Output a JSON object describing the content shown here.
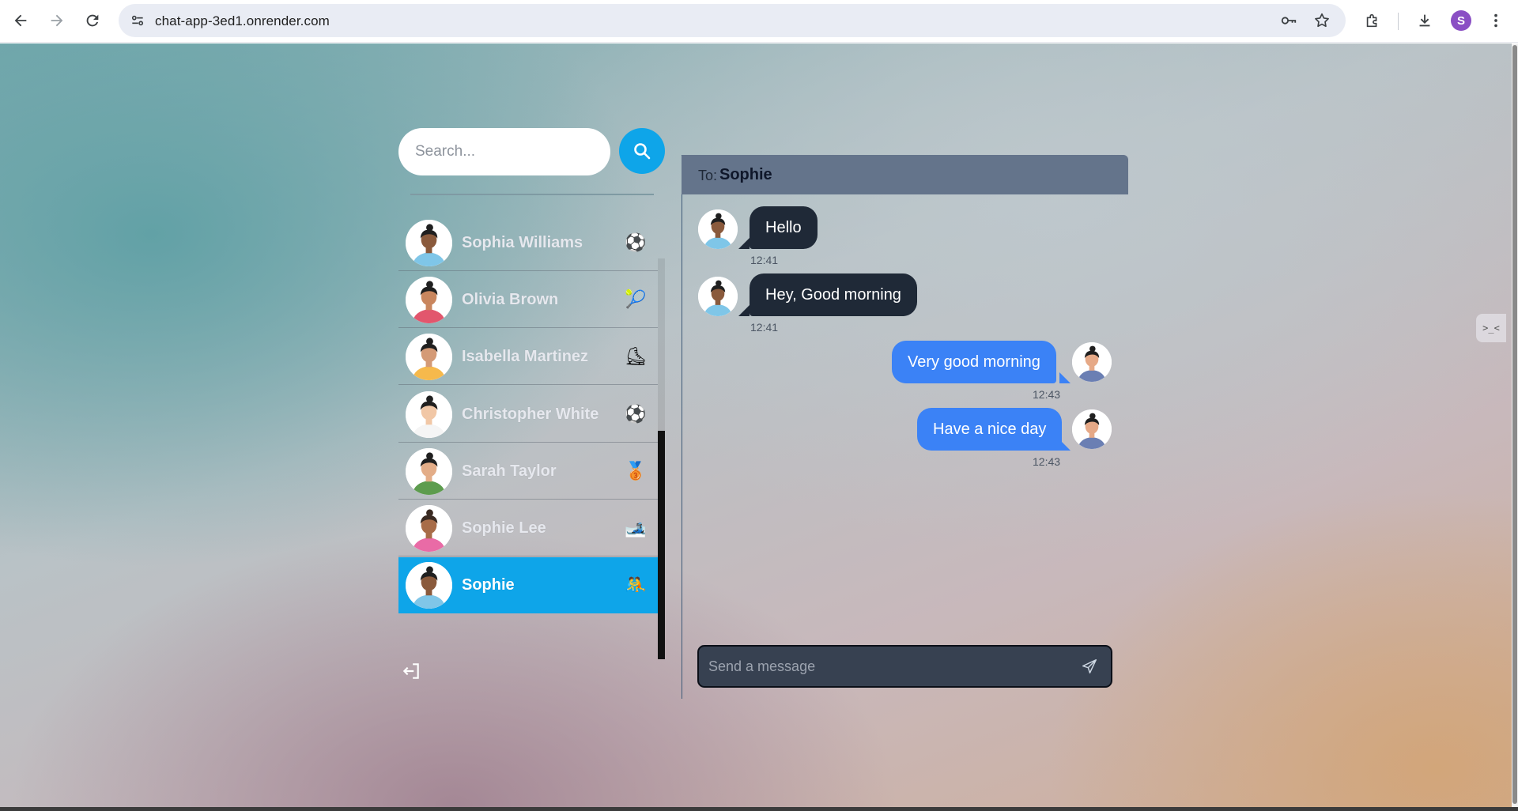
{
  "browser": {
    "url": "chat-app-3ed1.onrender.com",
    "profile_initial": "S",
    "icons": [
      "back-arrow-icon",
      "forward-arrow-icon",
      "reload-icon",
      "site-info-icon",
      "password-key-icon",
      "bookmark-star-icon",
      "extensions-icon",
      "download-icon",
      "menu-dots-icon"
    ]
  },
  "sidebar": {
    "search_placeholder": "Search...",
    "conversations": [
      {
        "name": "Sophia Williams",
        "emoji": "⚽",
        "avatar_bg": "#ffffff",
        "skin": "#8a5a3c",
        "hair": "#1f1f1f",
        "shirt": "#7fc6e8"
      },
      {
        "name": "Olivia Brown",
        "emoji": "🎾",
        "avatar_bg": "#ffffff",
        "skin": "#c9865e",
        "hair": "#1f1f1f",
        "shirt": "#e2566d"
      },
      {
        "name": "Isabella Martinez",
        "emoji": "⛸",
        "avatar_bg": "#ffffff",
        "skin": "#d49a76",
        "hair": "#1f1f1f",
        "shirt": "#f6b94c"
      },
      {
        "name": "Christopher White",
        "emoji": "⚽",
        "avatar_bg": "#ffffff",
        "skin": "#f1c7a6",
        "hair": "#1f1f1f",
        "shirt": "#f5f5f5"
      },
      {
        "name": "Sarah Taylor",
        "emoji": "🥉",
        "avatar_bg": "#ffffff",
        "skin": "#e3ad88",
        "hair": "#1f1f1f",
        "shirt": "#5d9c4e"
      },
      {
        "name": "Sophie Lee",
        "emoji": "🎿",
        "avatar_bg": "#ffffff",
        "skin": "#a86c48",
        "hair": "#3a2a22",
        "shirt": "#e96ba6"
      },
      {
        "name": "Sophie",
        "emoji": "🤼",
        "avatar_bg": "#ffffff",
        "skin": "#8a5a3c",
        "hair": "#1f1f1f",
        "shirt": "#7fc6e8",
        "selected": true
      }
    ]
  },
  "chat": {
    "to_label": "To:",
    "to_name": "Sophie",
    "messages": [
      {
        "text": "Hello",
        "time": "12:41",
        "from": "them"
      },
      {
        "text": "Hey, Good morning",
        "time": "12:41",
        "from": "them"
      },
      {
        "text": "Very good morning",
        "time": "12:43",
        "from": "me"
      },
      {
        "text": "Have a nice day",
        "time": "12:43",
        "from": "me"
      }
    ],
    "input_placeholder": "Send a message"
  },
  "colors": {
    "accent": "#0ea5e9",
    "sent_bubble": "#3b82f6",
    "received_bubble": "#1f2937",
    "header": "#64748b",
    "input_bg": "#374151"
  }
}
